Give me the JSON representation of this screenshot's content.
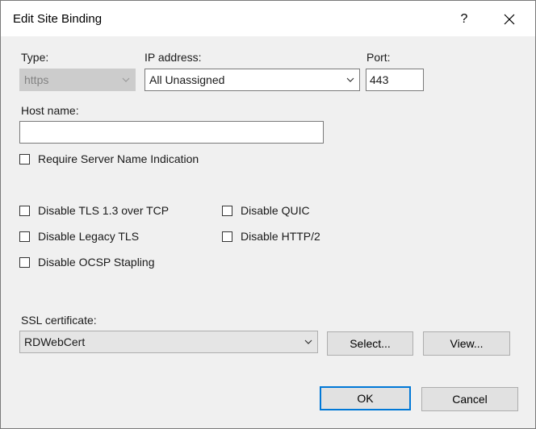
{
  "window": {
    "title": "Edit Site Binding",
    "help_label": "?"
  },
  "binding": {
    "type_label": "Type:",
    "type_value": "https",
    "ip_label": "IP address:",
    "ip_value": "All Unassigned",
    "port_label": "Port:",
    "port_value": "443",
    "host_label": "Host name:",
    "host_value": ""
  },
  "options": {
    "require_sni": {
      "label": "Require Server Name Indication",
      "checked": false
    },
    "disable_tls13": {
      "label": "Disable TLS 1.3 over TCP",
      "checked": false
    },
    "disable_quic": {
      "label": "Disable QUIC",
      "checked": false
    },
    "disable_legacy_tls": {
      "label": "Disable Legacy TLS",
      "checked": false
    },
    "disable_http2": {
      "label": "Disable HTTP/2",
      "checked": false
    },
    "disable_ocsp": {
      "label": "Disable OCSP Stapling",
      "checked": false
    }
  },
  "ssl": {
    "label": "SSL certificate:",
    "value": "RDWebCert",
    "select_label": "Select...",
    "view_label": "View..."
  },
  "footer": {
    "ok_label": "OK",
    "cancel_label": "Cancel"
  },
  "colors": {
    "accent": "#0078d7",
    "background": "#f0f0f0",
    "button": "#e1e1e1"
  }
}
